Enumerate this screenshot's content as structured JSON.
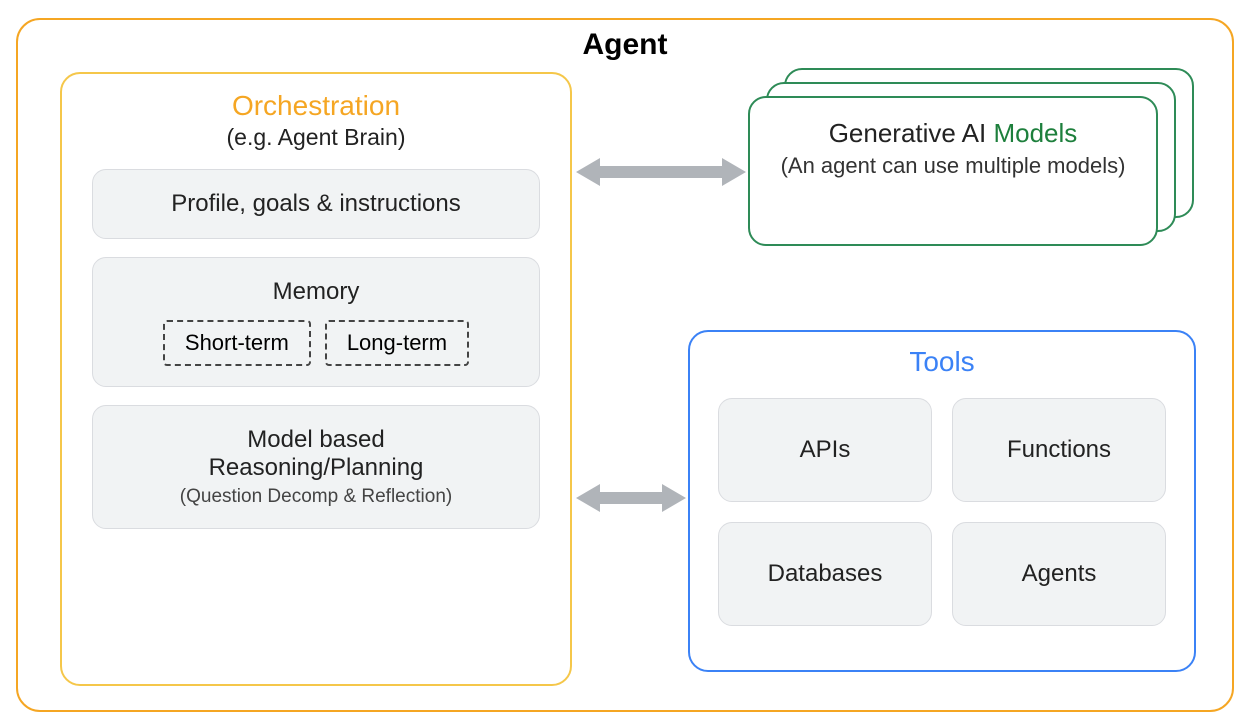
{
  "agent": {
    "title": "Agent"
  },
  "orchestration": {
    "title": "Orchestration",
    "subtitle": "(e.g. Agent Brain)",
    "profile": "Profile, goals & instructions",
    "memory": {
      "title": "Memory",
      "short": "Short-term",
      "long": "Long-term"
    },
    "reasoning": {
      "title1": "Model based",
      "title2": "Reasoning/Planning",
      "sub": "(Question Decomp & Reflection)"
    }
  },
  "models": {
    "line1a": "Generative AI ",
    "line1b": "Models",
    "line2": "(An agent can use multiple models)"
  },
  "tools": {
    "title": "Tools",
    "items": [
      "APIs",
      "Functions",
      "Databases",
      "Agents"
    ]
  }
}
